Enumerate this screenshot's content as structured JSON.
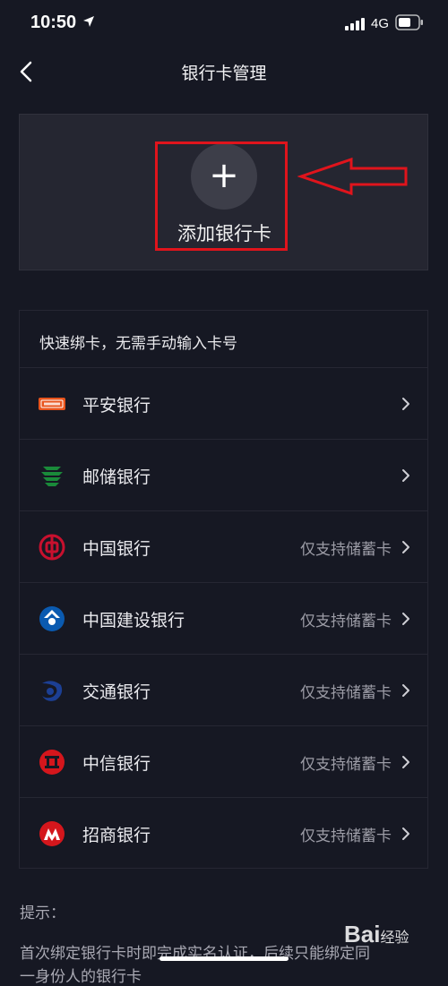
{
  "status_bar": {
    "time": "10:50",
    "network": "4G"
  },
  "nav": {
    "title": "银行卡管理"
  },
  "add_card": {
    "label": "添加银行卡",
    "plus": "+"
  },
  "bank_list": {
    "header": "快速绑卡，无需手动输入卡号",
    "banks": [
      {
        "name": "平安银行",
        "note": "",
        "color": "#e8541c"
      },
      {
        "name": "邮储银行",
        "note": "",
        "color": "#1a8a3a"
      },
      {
        "name": "中国银行",
        "note": "仅支持储蓄卡",
        "color": "#c8102e"
      },
      {
        "name": "中国建设银行",
        "note": "仅支持储蓄卡",
        "color": "#0a5ab0"
      },
      {
        "name": "交通银行",
        "note": "仅支持储蓄卡",
        "color": "#1c3f94"
      },
      {
        "name": "中信银行",
        "note": "仅支持储蓄卡",
        "color": "#d4161c"
      },
      {
        "name": "招商银行",
        "note": "仅支持储蓄卡",
        "color": "#d4161c"
      }
    ]
  },
  "tips": {
    "label": "提示：",
    "line1": "首次绑定银行卡时即完成实名认证，后续只能绑定同",
    "line2": "一身份人的银行卡"
  },
  "watermark": {
    "text": "Bai",
    "sub": "经验"
  },
  "colors": {
    "background": "#161823",
    "panel": "#252631",
    "annotation": "#e0141c"
  }
}
